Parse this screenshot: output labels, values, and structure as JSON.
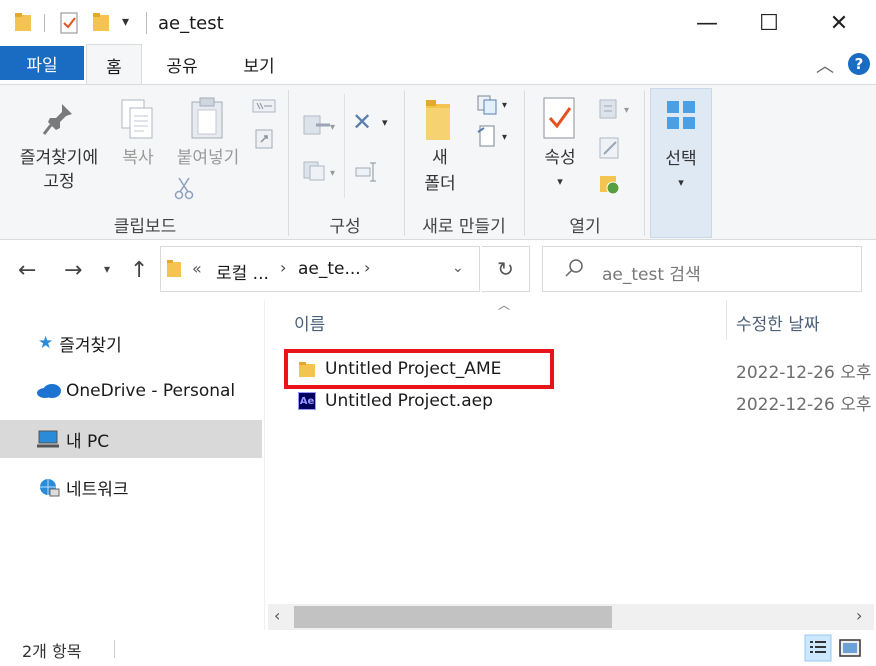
{
  "window": {
    "title": "ae_test",
    "minimize": "—",
    "maximize": "☐",
    "close": "✕"
  },
  "ribbon_tabs": {
    "file": "파일",
    "home": "홈",
    "share": "공유",
    "view": "보기"
  },
  "ribbon": {
    "pin": [
      "즐겨찾기에",
      "고정"
    ],
    "copy": "복사",
    "paste": "붙여넣기",
    "clipboard_group": "클립보드",
    "organize_group": "구성",
    "new_folder": [
      "새",
      "폴더"
    ],
    "new_group": "새로 만들기",
    "properties": "속성",
    "open_group": "열기",
    "select": "선택"
  },
  "address": {
    "overflow": "«",
    "crumbs": [
      "로컬 ...",
      "ae_te..."
    ],
    "search_placeholder": "ae_test 검색"
  },
  "nav_pane": {
    "items": [
      {
        "label": "즐겨찾기",
        "icon": "star-icon"
      },
      {
        "label": "OneDrive - Personal",
        "icon": "cloud-icon"
      },
      {
        "label": "내 PC",
        "icon": "computer-icon",
        "selected": true
      },
      {
        "label": "네트워크",
        "icon": "network-icon"
      }
    ]
  },
  "file_list": {
    "columns": {
      "name": "이름",
      "modified": "수정한 날짜"
    },
    "rows": [
      {
        "name": "Untitled Project_AME",
        "modified": "2022-12-26 오후",
        "icon": "folder-icon",
        "highlighted": true
      },
      {
        "name": "Untitled Project.aep",
        "modified": "2022-12-26 오후",
        "icon": "after-effects-file-icon"
      }
    ]
  },
  "status": {
    "count": "2개 항목"
  },
  "colors": {
    "accent": "#1a6cc2",
    "highlight_box": "#e8141a",
    "folder": "#f3c44f"
  }
}
